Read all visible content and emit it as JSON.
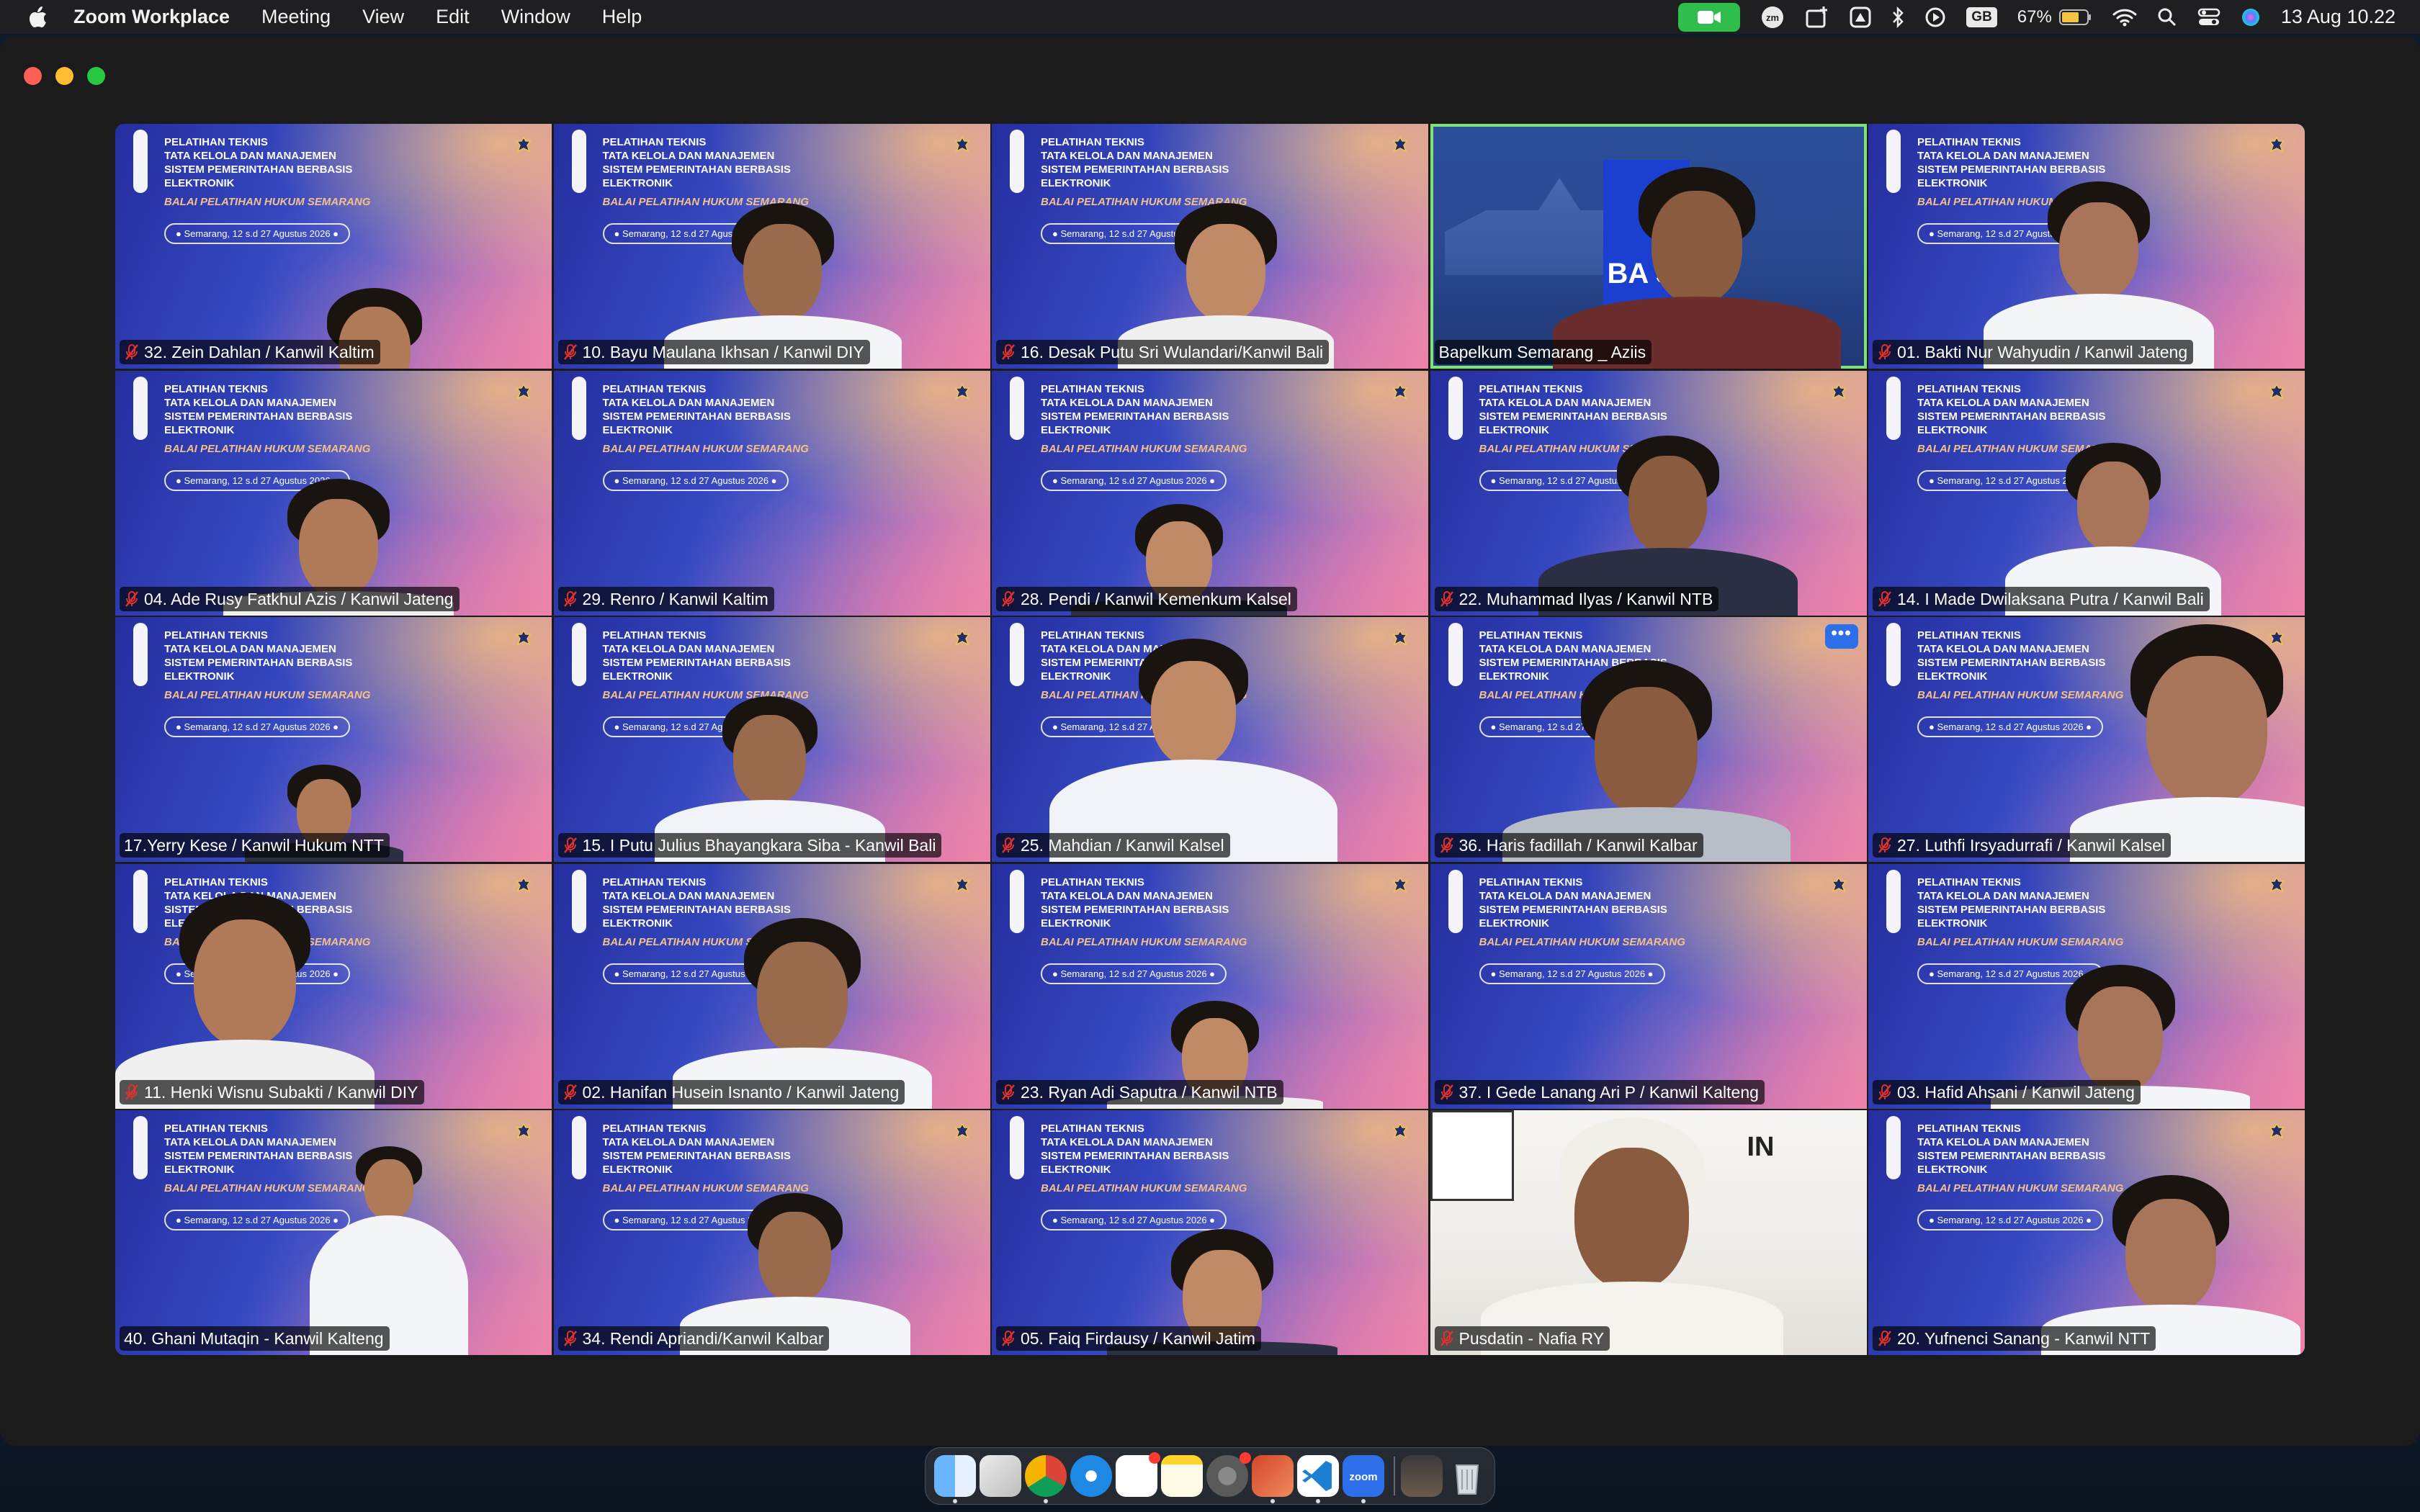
{
  "menubar": {
    "app_name": "Zoom Workplace",
    "menus": [
      "Meeting",
      "View",
      "Edit",
      "Window",
      "Help"
    ],
    "battery_percent": "67%",
    "keyboard_layout": "GB",
    "clock": "13 Aug  10.22",
    "camera_in_use": true
  },
  "virtual_background": {
    "title_lines": [
      "PELATIHAN TEKNIS",
      "TATA KELOLA DAN MANAJEMEN",
      "SISTEM PEMERINTAHAN BERBASIS",
      "ELEKTRONIK"
    ],
    "organizer": "BALAI PELATIHAN HUKUM SEMARANG",
    "date": "Semarang, 12 s.d 27 Agustus 2026"
  },
  "host_sign_text": "BA SEM",
  "room_sign_text": "IN",
  "participants": [
    {
      "name": "32. Zein Dahlan / Kanwil Kaltim",
      "muted": true
    },
    {
      "name": "10. Bayu Maulana Ikhsan / Kanwil DIY",
      "muted": true
    },
    {
      "name": "16. Desak Putu Sri Wulandari/Kanwil Bali",
      "muted": true
    },
    {
      "name": "Bapelkum Semarang _ Aziis",
      "muted": false,
      "active_speaker": true
    },
    {
      "name": "01. Bakti Nur Wahyudin / Kanwil Jateng",
      "muted": true
    },
    {
      "name": "04. Ade Rusy Fatkhul Azis / Kanwil Jateng",
      "muted": true
    },
    {
      "name": "29. Renro / Kanwil Kaltim",
      "muted": true
    },
    {
      "name": "28. Pendi / Kanwil Kemenkum Kalsel",
      "muted": true
    },
    {
      "name": "22. Muhammad Ilyas / Kanwil NTB",
      "muted": true
    },
    {
      "name": "14. I Made Dwilaksana Putra / Kanwil Bali",
      "muted": true
    },
    {
      "name": "17.Yerry Kese / Kanwil Hukum NTT",
      "muted": false
    },
    {
      "name": "15. I Putu Julius Bhayangkara Siba - Kanwil Bali",
      "muted": true
    },
    {
      "name": "25. Mahdian / Kanwil Kalsel",
      "muted": true
    },
    {
      "name": "36. Haris fadillah / Kanwil Kalbar",
      "muted": true,
      "hovered": true
    },
    {
      "name": "27. Luthfi Irsyadurrafi / Kanwil Kalsel",
      "muted": true
    },
    {
      "name": "11. Henki Wisnu Subakti / Kanwil DIY",
      "muted": true
    },
    {
      "name": "02. Hanifan Husein Isnanto / Kanwil Jateng",
      "muted": true
    },
    {
      "name": "23. Ryan Adi Saputra / Kanwil NTB",
      "muted": true
    },
    {
      "name": "37. I Gede Lanang Ari P / Kanwil Kalteng",
      "muted": true
    },
    {
      "name": "03. Hafid Ahsani / Kanwil Jateng",
      "muted": true
    },
    {
      "name": "40. Ghani Mutaqin - Kanwil Kalteng",
      "muted": false
    },
    {
      "name": "34. Rendi Apriandi/Kanwil Kalbar",
      "muted": true
    },
    {
      "name": "05. Faiq Firdausy / Kanwil Jatim",
      "muted": true
    },
    {
      "name": "Pusdatin - Nafia RY",
      "muted": true
    },
    {
      "name": "20. Yufnenci Sanang - Kanwil NTT",
      "muted": true
    }
  ],
  "more_options_label": "•••",
  "dock": {
    "apps": [
      "finder-icon",
      "launchpad-icon",
      "chrome-icon",
      "safari-icon",
      "reminders-icon",
      "notes-icon",
      "system-settings-icon",
      "powerpoint-icon",
      "vscode-icon",
      "zoom-icon"
    ],
    "trailing": [
      "downloads-stack-icon",
      "trash-icon"
    ]
  },
  "colors": {
    "active_speaker_border": "#7ee17a",
    "mute_red": "#e0322b",
    "zoom_blue": "#2d6fe8",
    "camera_green": "#2fbd4c"
  }
}
